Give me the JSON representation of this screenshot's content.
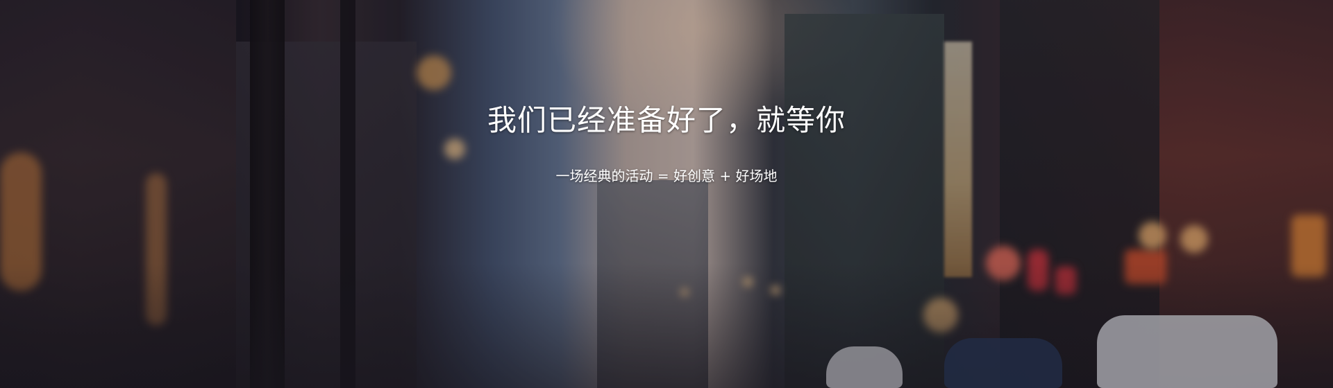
{
  "hero": {
    "title": "我们已经准备好了，就等你",
    "subtitle": "一场经典的活动 = 好创意 + 好场地"
  },
  "colors": {
    "text": "#ffffff",
    "sky_glow": "#d8c6bd",
    "lamp_glow": "#f5b060",
    "sign_red": "#e04040"
  }
}
